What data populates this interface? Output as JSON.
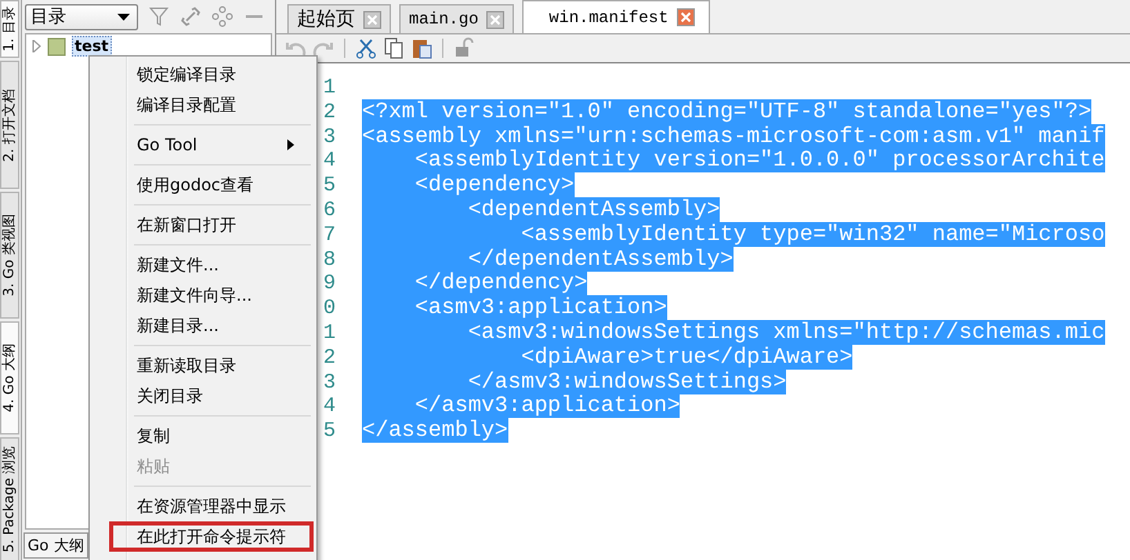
{
  "side_tabs": [
    {
      "label": "1. 目录",
      "selected": true
    },
    {
      "label": "2. 打开文档",
      "selected": false
    },
    {
      "label": "3. Go 类视图",
      "selected": false
    },
    {
      "label": "4. Go 大纲",
      "selected": true
    },
    {
      "label": "5. Package 浏览",
      "selected": false
    }
  ],
  "panel": {
    "combo": "目录",
    "tree": [
      {
        "label": "test",
        "selected": true,
        "expanded": false
      }
    ],
    "bottom_button": "Go 大纲"
  },
  "editor_tabs": [
    {
      "label": "起始页",
      "selected": false
    },
    {
      "label": "main.go",
      "selected": false
    },
    {
      "label": "win.manifest",
      "selected": true
    }
  ],
  "editor": {
    "text_selected": true,
    "lines": [
      {
        "number": "1"
      },
      {
        "number": "2",
        "text": "<?xml version=\"1.0\" encoding=\"UTF-8\" standalone=\"yes\"?>"
      },
      {
        "number": "3",
        "text": "<assembly xmlns=\"urn:schemas-microsoft-com:asm.v1\" manif"
      },
      {
        "number": "4",
        "text": "    <assemblyIdentity version=\"1.0.0.0\" processorArchite"
      },
      {
        "number": "5",
        "text": "    <dependency>"
      },
      {
        "number": "6",
        "text": "        <dependentAssembly>"
      },
      {
        "number": "7",
        "text": "            <assemblyIdentity type=\"win32\" name=\"Microso"
      },
      {
        "number": "8",
        "text": "        </dependentAssembly>"
      },
      {
        "number": "9",
        "text": "    </dependency>"
      },
      {
        "number": "0",
        "text": "    <asmv3:application>"
      },
      {
        "number": "1",
        "text": "        <asmv3:windowsSettings xmlns=\"http://schemas.mic"
      },
      {
        "number": "2",
        "text": "            <dpiAware>true</dpiAware>"
      },
      {
        "number": "3",
        "text": "        </asmv3:windowsSettings>"
      },
      {
        "number": "4",
        "text": "    </asmv3:application>"
      },
      {
        "number": "5",
        "text": "</assembly>"
      }
    ]
  },
  "context_menu": [
    {
      "kind": "item",
      "label": "锁定编译目录",
      "disabled": false,
      "highlighted": false
    },
    {
      "kind": "item",
      "label": "编译目录配置",
      "disabled": false,
      "highlighted": false
    },
    {
      "kind": "separator"
    },
    {
      "kind": "submenu",
      "label": "Go Tool",
      "disabled": false,
      "highlighted": false
    },
    {
      "kind": "separator"
    },
    {
      "kind": "item",
      "label": "使用godoc查看",
      "disabled": false,
      "highlighted": false
    },
    {
      "kind": "separator"
    },
    {
      "kind": "item",
      "label": "在新窗口打开",
      "disabled": false,
      "highlighted": false
    },
    {
      "kind": "separator"
    },
    {
      "kind": "item",
      "label": "新建文件...",
      "disabled": false,
      "highlighted": false
    },
    {
      "kind": "item",
      "label": "新建文件向导...",
      "disabled": false,
      "highlighted": false
    },
    {
      "kind": "item",
      "label": "新建目录...",
      "disabled": false,
      "highlighted": false
    },
    {
      "kind": "separator"
    },
    {
      "kind": "item",
      "label": "重新读取目录",
      "disabled": false,
      "highlighted": false
    },
    {
      "kind": "item",
      "label": "关闭目录",
      "disabled": false,
      "highlighted": false
    },
    {
      "kind": "separator"
    },
    {
      "kind": "item",
      "label": "复制",
      "disabled": false,
      "highlighted": false
    },
    {
      "kind": "item",
      "label": "粘贴",
      "disabled": true,
      "highlighted": false
    },
    {
      "kind": "separator"
    },
    {
      "kind": "item",
      "label": "在资源管理器中显示",
      "disabled": false,
      "highlighted": false
    },
    {
      "kind": "item",
      "label": "在此打开命令提示符",
      "disabled": false,
      "highlighted": true
    }
  ]
}
